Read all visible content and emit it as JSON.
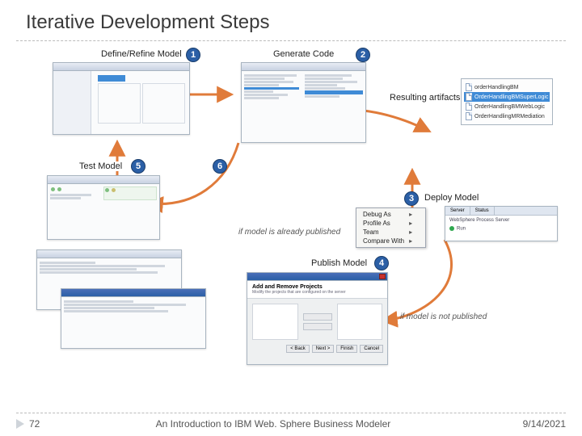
{
  "title": "Iterative Development Steps",
  "sections": {
    "s1": "Define/Refine Model",
    "s2": "Generate Code",
    "s3": "Deploy Model",
    "s4": "Publish Model",
    "s5": "Test Model",
    "s6_badge_only": "6",
    "resulting_artifacts": "Resulting artifacts"
  },
  "captions": {
    "already_published": "if model is already published",
    "not_published": "if model is not published"
  },
  "artifacts": [
    "orderHandlingBM",
    "OrderHandlingBMSuperLogic",
    "OrderHandlingBMWebLogic",
    "OrderHandlingMRMediation"
  ],
  "context_menu": {
    "debug_as": "Debug As",
    "profile_as": "Profile As",
    "team": "Team",
    "compare_with": "Compare With"
  },
  "server_panel": {
    "col_server": "Server",
    "col_status": "Status",
    "server_name": "WebSphere Process Server",
    "run_label": "Run"
  },
  "dialog": {
    "title": "Add and Remove Projects",
    "subtitle": "Modify the projects that are configured on the server",
    "btn_back": "< Back",
    "btn_next": "Next >",
    "btn_finish": "Finish",
    "btn_cancel": "Cancel"
  },
  "footer": {
    "page": "72",
    "doc_title": "An Introduction to IBM Web. Sphere Business Modeler",
    "date": "9/14/2021"
  }
}
